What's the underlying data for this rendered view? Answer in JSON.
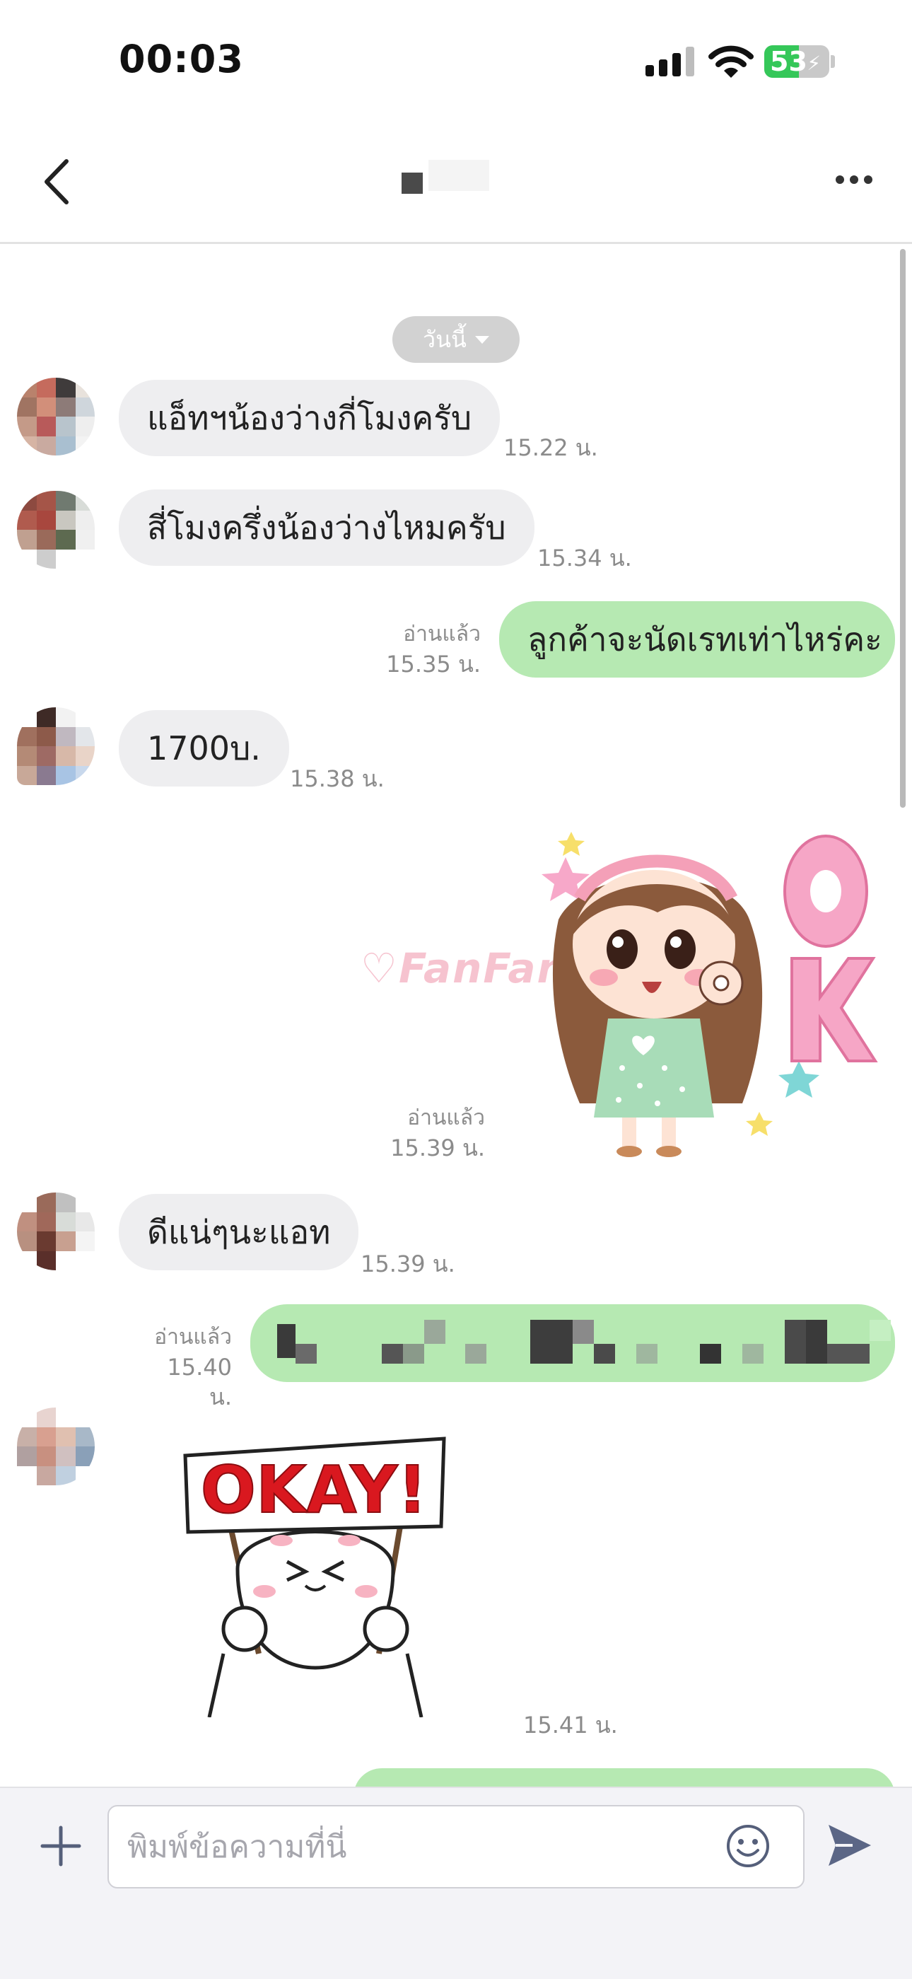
{
  "status_bar": {
    "time": "00:03",
    "battery": "53"
  },
  "header": {},
  "date_pill": {
    "label": "วันนี้"
  },
  "messages": [
    {
      "text": "แอ็ทฯน้องว่างกี่โมงครับ",
      "time": "15.22 น."
    },
    {
      "text": "สี่โมงครึ่งน้องว่างไหมครับ",
      "time": "15.34 น."
    },
    {
      "text": "ลูกค้าจะนัดเรทเท่าไหร่คะ",
      "read": "อ่านแล้ว",
      "time": "15.35 น."
    },
    {
      "text": "1700บ.",
      "time": "15.38 น."
    },
    {
      "sticker": "ok-girl-sticker",
      "watermark": "FanFan",
      "read": "อ่านแล้ว",
      "time": "15.39 น."
    },
    {
      "text": "ดีแน่ๆนะแอท",
      "time": "15.39 น."
    },
    {
      "text_pixelated": true,
      "read": "อ่านแล้ว",
      "time": "15.40 น."
    },
    {
      "sticker": "okay-sign-bear-sticker",
      "sign_text": "OKAY!",
      "time": "15.41 น."
    }
  ],
  "input": {
    "placeholder": "พิมพ์ข้อความที่นี่"
  },
  "colors": {
    "outgoing_bubble": "#b6e9b2",
    "incoming_bubble": "#eeeef0",
    "battery": "#35c759"
  }
}
